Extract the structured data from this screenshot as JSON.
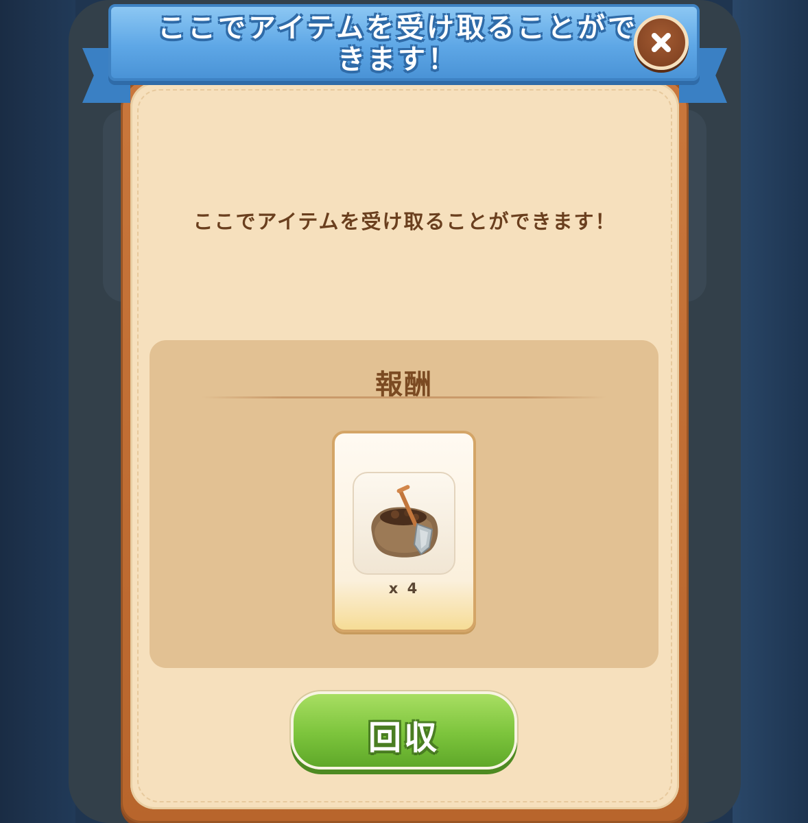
{
  "dialog": {
    "title": "ここでアイテムを受け取ることができます！",
    "message": "ここでアイテムを受け取ることができます！",
    "close_icon": "close-icon"
  },
  "reward": {
    "title": "報酬",
    "item": {
      "icon": "dirt-sack-shovel-icon",
      "quantity": "x 4"
    }
  },
  "actions": {
    "collect_label": "回収"
  },
  "colors": {
    "ribbon": "#5ea7e6",
    "dialog_frame": "#c9773c",
    "dialog_body": "#f6e0bd",
    "collect_button": "#7cc43c"
  }
}
